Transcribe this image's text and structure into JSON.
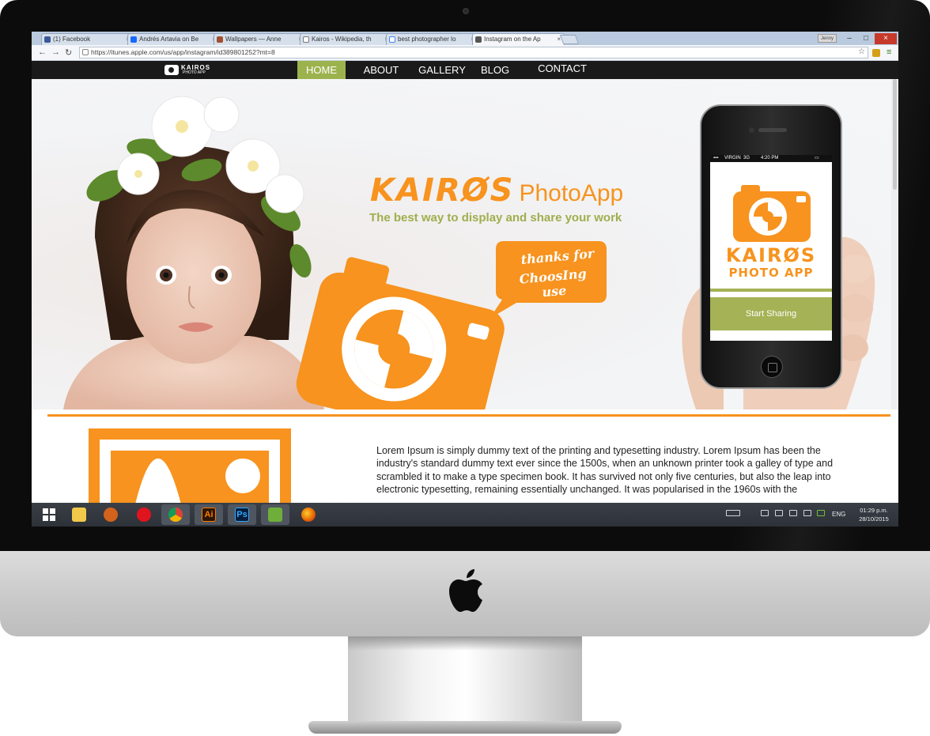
{
  "browser": {
    "tabs": [
      {
        "label": "(1) Facebook",
        "favicon": "facebook-icon",
        "color": "#3b5998"
      },
      {
        "label": "Andrés Artavia on Be",
        "favicon": "behance-icon",
        "color": "#1769ff"
      },
      {
        "label": "Wallpapers — Anne",
        "favicon": "wallpapers-icon",
        "color": "#a05030"
      },
      {
        "label": "Kairos - Wikipedia, th",
        "favicon": "wikipedia-icon",
        "color": "#777777"
      },
      {
        "label": "best photographer lo",
        "favicon": "google-icon",
        "color": "#4285f4"
      },
      {
        "label": "Instagram on the Ap",
        "favicon": "appstore-icon",
        "color": "#555555"
      }
    ],
    "user_badge": "Jenny",
    "url": "https://itunes.apple.com/us/app/instagram/id389801252?mt=8"
  },
  "site": {
    "logo": {
      "title": "KAIROS",
      "subtitle": "PHOTO APP"
    },
    "nav": [
      "HOME",
      "ABOUT",
      "GALLERY",
      "BLOG",
      "CONTACT"
    ],
    "active_nav": "HOME",
    "hero": {
      "brand": "KAIRØS",
      "brand_suffix": "PhotoApp",
      "tagline": "The best way to display and share your work",
      "bubble_line1": "thanks for",
      "bubble_line2": "ChoosIng use"
    },
    "phone": {
      "carrier": "VIRGIN",
      "network": "3G",
      "time": "4:20 PM",
      "app_title": "KAIRØS",
      "app_subtitle": "PHOTO APP",
      "cta": "Start Sharing"
    },
    "body_text": "Lorem Ipsum is simply dummy text of the printing and typesetting industry. Lorem Ipsum has been the industry's standard dummy text ever since the 1500s, when an unknown printer took a galley of type and scrambled it to make a type specimen book. It has survived not only five centuries, but also the leap into electronic typesetting, remaining essentially unchanged. It was popularised in the 1960s with the"
  },
  "taskbar": {
    "apps": [
      "windows-start-icon",
      "file-explorer-icon",
      "app-icon",
      "opera-icon",
      "chrome-icon",
      "illustrator-icon",
      "photoshop-icon",
      "app-icon-2",
      "firefox-icon"
    ],
    "illustrator_label": "Ai",
    "photoshop_label": "Ps",
    "language": "ENG",
    "time": "01:29 p.m.",
    "date": "28/10/2015"
  },
  "colors": {
    "accent_orange": "#f7931e",
    "accent_green": "#9cb34d"
  }
}
